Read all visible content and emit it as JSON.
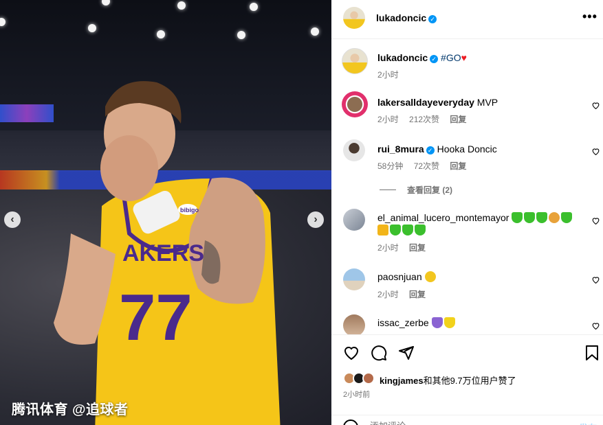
{
  "photo": {
    "watermark": "腾讯体育 @追球者",
    "jersey_number": "77",
    "jersey_text": "AKERS",
    "patch_text": "bibigo",
    "nav_prev": "‹",
    "nav_next": "›"
  },
  "header": {
    "username": "lukadoncic",
    "verified": "✓",
    "more": "•••"
  },
  "caption": {
    "username": "lukadoncic",
    "verified": "✓",
    "hashtag": "#GO",
    "heart": "♥",
    "time": "2小时"
  },
  "comments": [
    {
      "username": "lakersalldayeveryday",
      "text": "MVP",
      "time": "2小时",
      "likes": "212次赞",
      "reply": "回复"
    },
    {
      "username": "rui_8mura",
      "verified": "✓",
      "text": "Hooka Doncic",
      "time": "58分钟",
      "likes": "72次赞",
      "reply": "回复"
    },
    {
      "username": "el_animal_lucero_montemayor",
      "time": "2小时",
      "reply": "回复"
    },
    {
      "username": "paosnjuan",
      "time": "2小时",
      "reply": "回复"
    },
    {
      "username": "issac_zerbe"
    }
  ],
  "view_replies": "查看回复 (2)",
  "likes": {
    "user": "kingjames",
    "rest": "和其他9.7万位用户赞了"
  },
  "timestamp": "2小时前",
  "comment_bar": {
    "placeholder": "添加评论……",
    "post": "发布"
  },
  "colors": {
    "accent": "#0095f6",
    "meta": "#737373",
    "jersey": "#f5c518",
    "jersey_trim": "#4a2a8c"
  }
}
